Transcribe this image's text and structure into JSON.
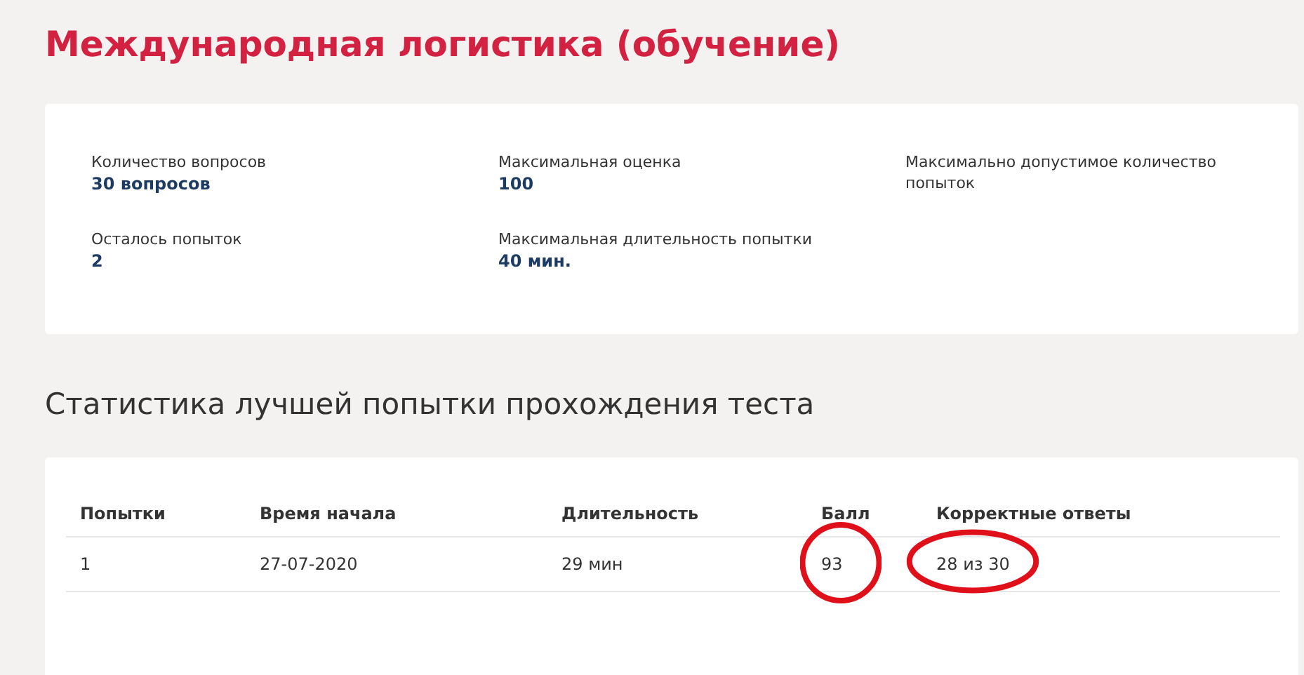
{
  "title": "Международная логистика (обучение)",
  "info": [
    {
      "label": "Количество вопросов",
      "value": "30 вопросов"
    },
    {
      "label": "Максимальная оценка",
      "value": "100"
    },
    {
      "label": "Максимально допустимое количество попыток"
    },
    {
      "label": "Осталось попыток",
      "value": "2"
    },
    {
      "label": "Максимальная длительность попытки",
      "value": "40 мин."
    }
  ],
  "stats_heading": "Статистика лучшей попытки прохождения теста",
  "table": {
    "columns": [
      "Попытки",
      "Время начала",
      "Длительность",
      "Балл",
      "Корректные ответы"
    ],
    "rows": [
      [
        {
          "text": "1",
          "circled": false
        },
        {
          "text": "27-07-2020",
          "circled": false
        },
        {
          "text": "29 мин",
          "circled": false
        },
        {
          "text": "93",
          "circled": true
        },
        {
          "text": "28 из 30",
          "circled": true
        }
      ]
    ]
  }
}
